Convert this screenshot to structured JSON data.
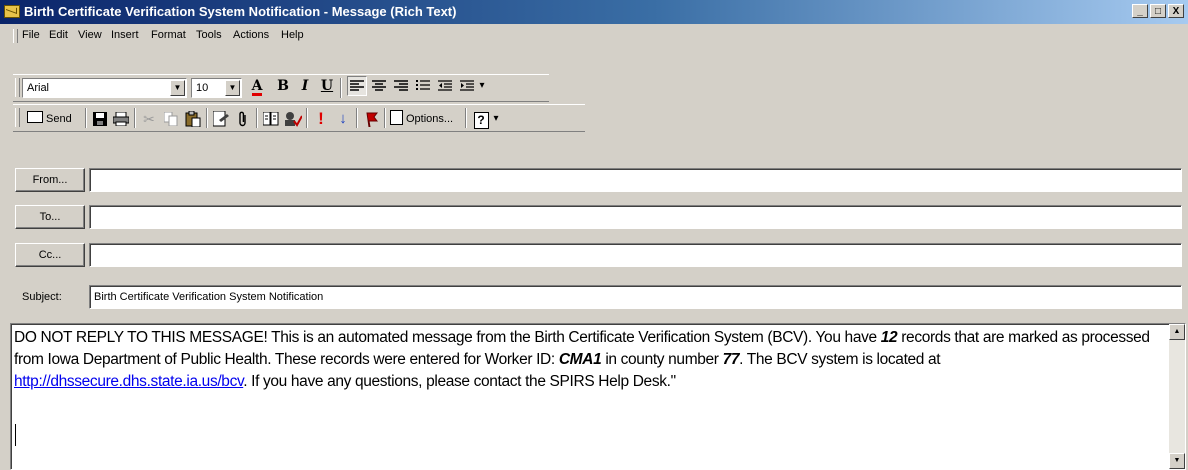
{
  "window": {
    "title": "Birth Certificate Verification System Notification - Message (Rich Text)",
    "controls": [
      "_",
      "□",
      "X"
    ]
  },
  "menu": [
    {
      "label": "File"
    },
    {
      "label": "Edit"
    },
    {
      "label": "View"
    },
    {
      "label": "Insert"
    },
    {
      "label": "Format"
    },
    {
      "label": "Tools"
    },
    {
      "label": "Actions"
    },
    {
      "label": "Help"
    }
  ],
  "format_toolbar": {
    "font": "Arial",
    "size": "10",
    "font_color_glyph": "A",
    "bold": "B",
    "italic": "I",
    "underline": "U"
  },
  "standard_toolbar": {
    "send_label": "Send",
    "options_label": "Options...",
    "help_glyph": "?"
  },
  "header": {
    "from_button": "From...",
    "to_button": "To...",
    "cc_button": "Cc...",
    "subject_label": "Subject:",
    "from_value": "",
    "to_value": "",
    "cc_value": "",
    "subject_value": "Birth Certificate Verification System Notification"
  },
  "body": {
    "p1": "DO NOT REPLY TO THIS MESSAGE!  This is an automated message from the Birth Certificate Verification System (BCV).  You have ",
    "record_count": "12",
    "p2": " records that are marked as processed from Iowa Department of Public Health.  These records were entered for Worker ID: ",
    "worker_id": "CMA1",
    "p3": " in county number ",
    "county": "77",
    "p4": ".  The BCV system is located at ",
    "link": "http://dhssecure.dhs.state.ia.us/bcv",
    "p5": ".  If you have any questions, please contact the SPIRS Help Desk.\""
  }
}
